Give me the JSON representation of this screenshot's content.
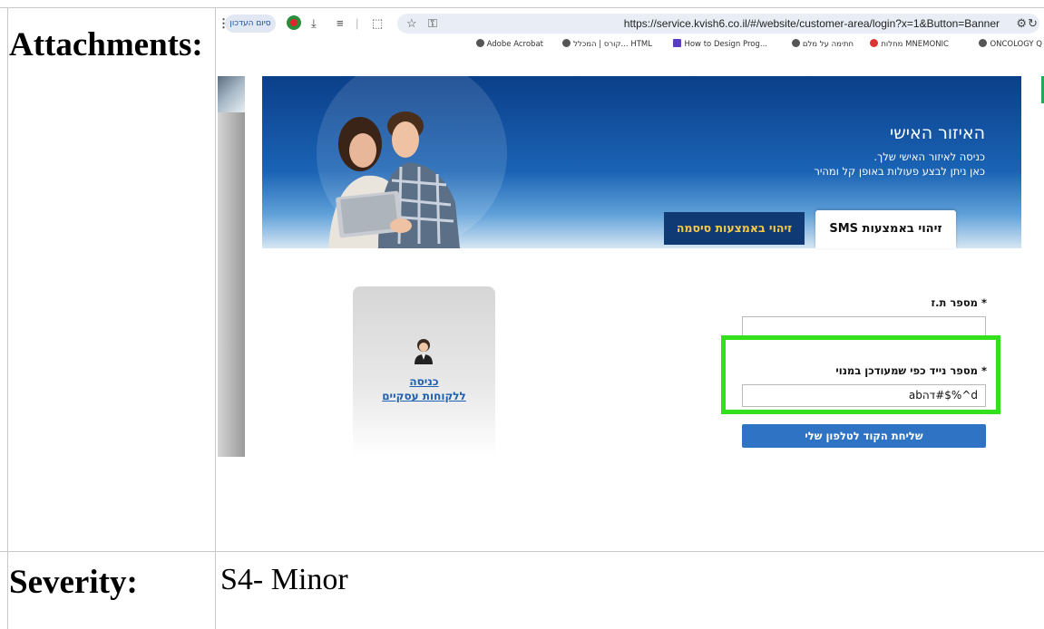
{
  "document": {
    "attachments_label": "Attachments:",
    "severity_label": "Severity:",
    "severity_value": "S4- Minor"
  },
  "browser": {
    "url": "https://service.kvish6.co.il/#/website/customer-area/login?x=1&Button=Banner",
    "resume_button": "סיום העדכון",
    "bookmarks": [
      {
        "label": "ONCOLOGY Q",
        "icon": "globe-icon"
      },
      {
        "label": "מחלות MNEMONIC",
        "icon": "heart-icon"
      },
      {
        "label": "חתימה על מלם",
        "icon": "globe-icon"
      },
      {
        "label": "How to Design Prog...",
        "icon": "bookmark-icon"
      },
      {
        "label": "קורס | המכלל... HTML",
        "icon": "globe-icon"
      },
      {
        "label": "Adobe Acrobat",
        "icon": "globe-icon"
      }
    ]
  },
  "hero": {
    "title": "האיזור האישי",
    "subtitle_1": "כניסה לאיזור האישי שלך.",
    "subtitle_2": "כאן ניתן לבצע פעולות באופן קל ומהיר"
  },
  "tabs": {
    "sms": "זיהוי באמצעות SMS",
    "password": "זיהוי באמצעות סיסמה"
  },
  "form": {
    "id_label": "* מספר ת.ז",
    "id_value": "",
    "phone_label": "* מספר נייד כפי שמעודכן במנוי",
    "phone_value": "abדה#$%^d",
    "send_button": "שליחת הקוד לטלפון שלי"
  },
  "business": {
    "link_line1": "כניסה",
    "link_line2": "ללקוחות עסקיים"
  },
  "colors": {
    "highlight": "#33e01c",
    "primary_button": "#2f73c5",
    "password_tab": "#0f3a74",
    "password_tab_text": "#f7c948"
  }
}
